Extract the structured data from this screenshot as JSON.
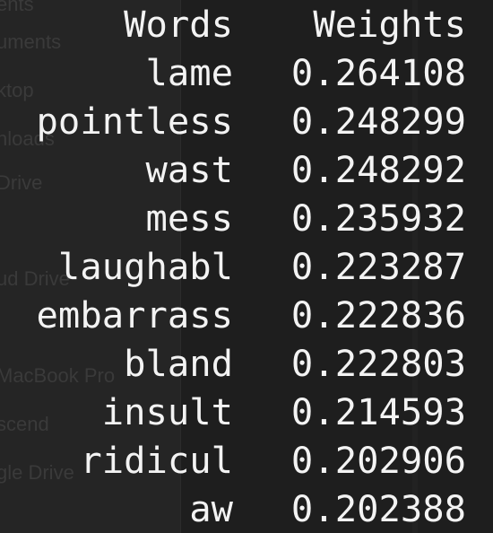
{
  "background_sidebar": {
    "items": [
      "ents",
      "uments",
      "ktop",
      "nloads",
      "Drive",
      "ud Drive",
      "MacBook Pro",
      "scend",
      "gle Drive"
    ]
  },
  "table": {
    "headers": {
      "word": "Words",
      "weight": "Weights"
    },
    "rows": [
      {
        "word": "lame",
        "weight": "0.264108"
      },
      {
        "word": "pointless",
        "weight": "0.248299"
      },
      {
        "word": "wast",
        "weight": "0.248292"
      },
      {
        "word": "mess",
        "weight": "0.235932"
      },
      {
        "word": "laughabl",
        "weight": "0.223287"
      },
      {
        "word": "embarrass",
        "weight": "0.222836"
      },
      {
        "word": "bland",
        "weight": "0.222803"
      },
      {
        "word": "insult",
        "weight": "0.214593"
      },
      {
        "word": "ridicul",
        "weight": "0.202906"
      },
      {
        "word": "aw",
        "weight": "0.202388"
      }
    ]
  },
  "colors": {
    "background": "#1e1e1e",
    "text": "#f3f3f3",
    "ghost_text": "#3a3a3a"
  }
}
